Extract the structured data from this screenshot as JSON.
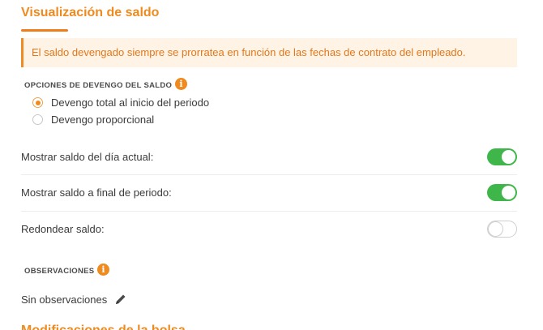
{
  "section": {
    "title": "Visualización de saldo",
    "info_banner": "El saldo devengado siempre se prorratea en función de las fechas de contrato del empleado."
  },
  "accrual_options": {
    "label": "OPCIONES DE DEVENGO DEL SALDO",
    "info_icon": "i",
    "options": [
      {
        "label": "Devengo total al inicio del periodo",
        "selected": true
      },
      {
        "label": "Devengo proporcional",
        "selected": false
      }
    ]
  },
  "settings": [
    {
      "label": "Mostrar saldo del día actual:",
      "enabled": true
    },
    {
      "label": "Mostrar saldo a final de periodo:",
      "enabled": true
    },
    {
      "label": "Redondear saldo:",
      "enabled": false
    }
  ],
  "observations": {
    "label": "OBSERVACIONES",
    "info_icon": "i",
    "value": "Sin observaciones",
    "edit_icon": "pencil-icon"
  },
  "next_section": {
    "title": "Modificaciones de la bolsa"
  },
  "colors": {
    "accent": "#ef8a1f",
    "toggle_on": "#3fb64a",
    "banner_bg": "#fff3e6"
  }
}
